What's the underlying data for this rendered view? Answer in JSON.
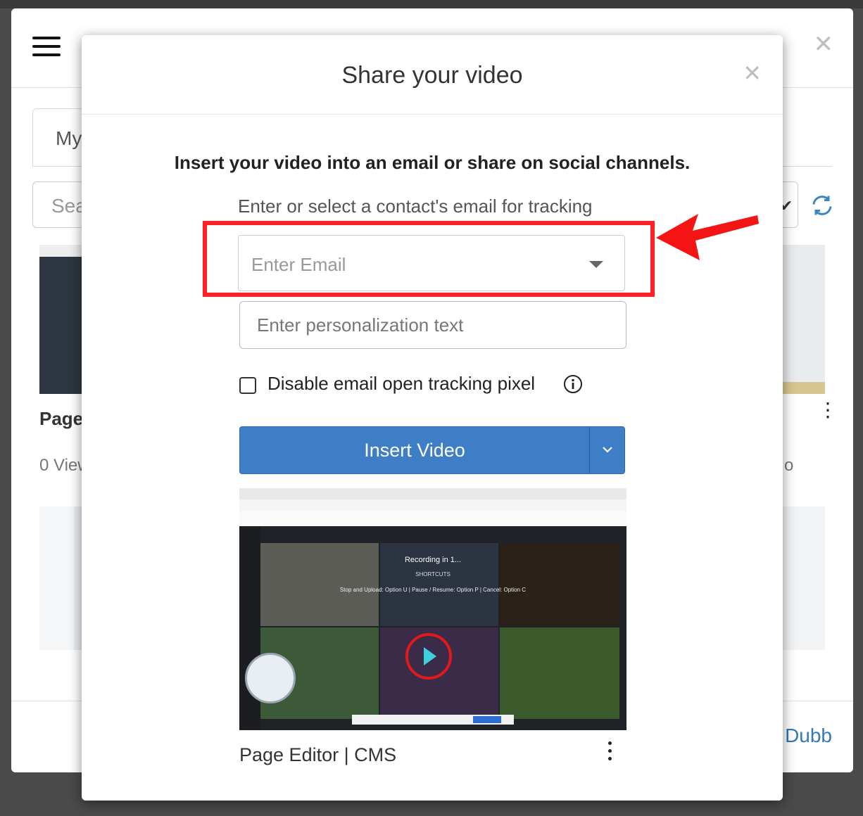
{
  "background": {
    "tab_label": "My",
    "search_placeholder": "Sea",
    "card_title": "Page",
    "card_views_left": "0 View",
    "card_views_right": "o",
    "brand_text": "Dubb"
  },
  "modal": {
    "title": "Share your video",
    "lead": "Insert your video into an email or share on social channels.",
    "hint": "Enter or select a contact's email for tracking",
    "email_placeholder": "Enter Email",
    "personalization_placeholder": "Enter personalization text",
    "checkbox_label": "Disable email open tracking pixel",
    "checkbox_checked": false,
    "insert_button": "Insert Video",
    "video_title": "Page Editor | CMS",
    "video_preview": {
      "recording_text": "Recording in 1...",
      "shortcuts_text": "SHORTCUTS",
      "controls_text": "Stop and Upload: Option U  |  Pause / Resume: Option P  |  Cancel: Option C"
    }
  },
  "colors": {
    "primary_button": "#3d7ec7",
    "highlight": "#ff2222",
    "brand_link": "#337ab7"
  },
  "icons": [
    "hamburger-icon",
    "close-icon",
    "refresh-icon",
    "chevron-down-icon",
    "info-icon",
    "kebab-icon",
    "caret-down-icon"
  ]
}
